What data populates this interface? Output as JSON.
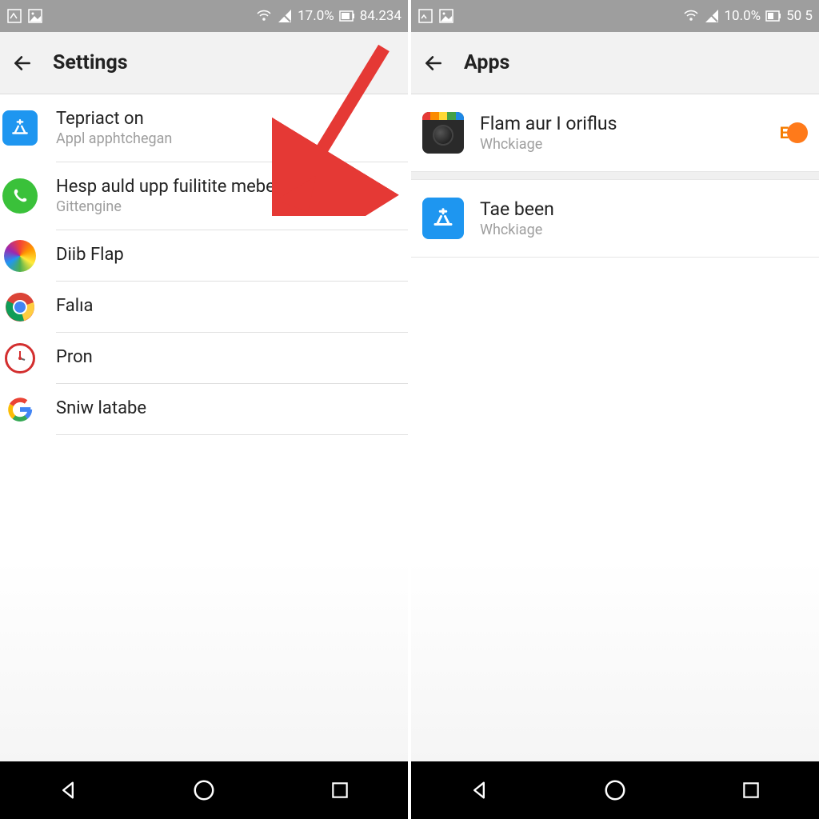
{
  "left": {
    "status": {
      "battery_pct": "17.0%",
      "clock": "84.234"
    },
    "header": {
      "title": "Settings"
    },
    "items": [
      {
        "title": "Tepriact on",
        "sub": "Appl apphtchegan",
        "icon": "appstore"
      },
      {
        "title": "Hesp auld upp fuilitite mebean",
        "sub": "Gittengine",
        "icon": "phone"
      },
      {
        "title": "Diib Flap",
        "sub": "",
        "icon": "colorful"
      },
      {
        "title": "Falıa",
        "sub": "",
        "icon": "chrome"
      },
      {
        "title": "Pron",
        "sub": "",
        "icon": "clock"
      },
      {
        "title": "Sniw latabe",
        "sub": "",
        "icon": "google-g"
      }
    ]
  },
  "right": {
    "status": {
      "battery_pct": "10.0%",
      "clock": "50 5"
    },
    "header": {
      "title": "Apps"
    },
    "items": [
      {
        "title": "Flam aur I oriflus",
        "sub": "Whckiage",
        "icon": "camera",
        "toggle": true
      },
      {
        "title": "Tae been",
        "sub": "Whckiage",
        "icon": "appstore"
      }
    ]
  },
  "colors": {
    "accent": "#ff7a1a",
    "arrow": "#e53935"
  }
}
